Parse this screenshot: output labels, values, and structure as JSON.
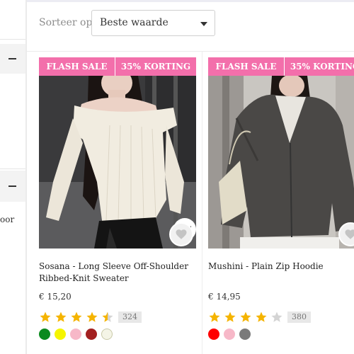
{
  "sidebar": {
    "partial_text": "oor"
  },
  "sort": {
    "label": "Sorteer op:",
    "value": "Beste waarde"
  },
  "products": [
    {
      "flash_label": "FLASH SALE",
      "discount_label": "35% KORTING",
      "title": "Sosana - Long Sleeve Off-Shoulder Ribbed-Knit Sweater",
      "price": "€ 15,20",
      "rating": 4.5,
      "review_count": "324",
      "colors": [
        "#0a8a1e",
        "#f5f500",
        "#f7b8c8",
        "#a32020",
        "#f4f4e6"
      ]
    },
    {
      "flash_label": "FLASH SALE",
      "discount_label": "35% KORTING",
      "title": "Mushini - Plain Zip Hoodie",
      "price": "€ 14,95",
      "rating": 4,
      "review_count": "380",
      "colors": [
        "#ff0000",
        "#f7b8c8",
        "#7a7a7a"
      ]
    }
  ],
  "colors": {
    "banner": "#f36fab",
    "star": "#f5b400",
    "star_empty": "#d4d4d4"
  }
}
